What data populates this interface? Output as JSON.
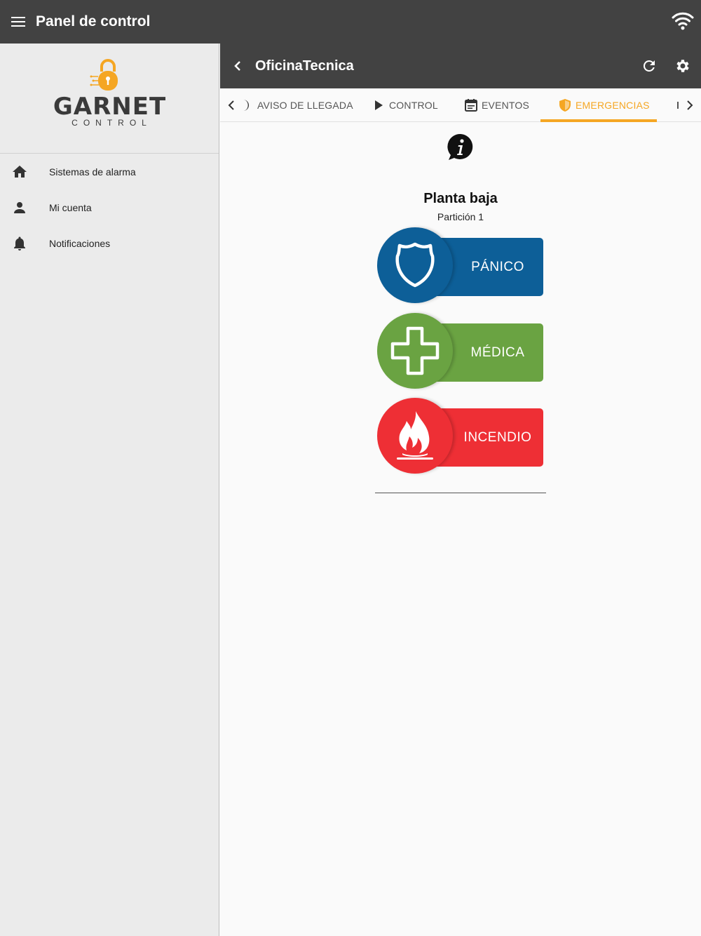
{
  "appbar": {
    "title": "Panel de control",
    "menu_icon": "menu-icon",
    "wifi_icon": "wifi-icon"
  },
  "logo": {
    "brand": "GARNET",
    "sub": "CONTROL",
    "accent": "#f5a623"
  },
  "sidebar": {
    "items": [
      {
        "label": "Sistemas de alarma",
        "icon": "home-icon"
      },
      {
        "label": "Mi cuenta",
        "icon": "person-icon"
      },
      {
        "label": "Notificaciones",
        "icon": "bell-icon"
      }
    ]
  },
  "panel": {
    "title": "OficinaTecnica",
    "back_icon": "chevron-left-icon",
    "refresh_icon": "refresh-icon",
    "settings_icon": "gear-icon"
  },
  "tabs": [
    {
      "label": "AVISO DE LLEGADA",
      "icon": "half-moon-icon",
      "active": false
    },
    {
      "label": "CONTROL",
      "icon": "play-icon",
      "active": false
    },
    {
      "label": "EVENTOS",
      "icon": "calendar-icon",
      "active": false
    },
    {
      "label": "EMERGENCIAS",
      "icon": "shield-icon",
      "active": true
    }
  ],
  "zone": {
    "title": "Planta baja",
    "subtitle": "Partición 1"
  },
  "emergencies": [
    {
      "label": "PÁNICO",
      "icon": "police-shield-icon",
      "color": "#0d5f98"
    },
    {
      "label": "MÉDICA",
      "icon": "medical-cross-icon",
      "color": "#6aa342"
    },
    {
      "label": "INCENDIO",
      "icon": "fire-icon",
      "color": "#ee2f35"
    }
  ]
}
